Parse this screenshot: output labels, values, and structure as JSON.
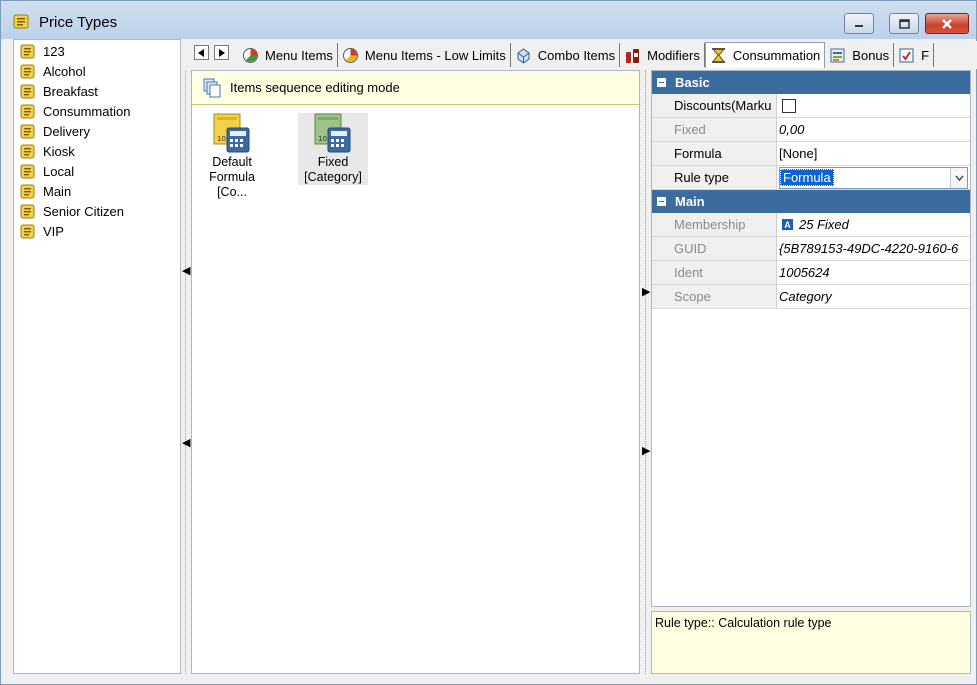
{
  "window": {
    "title": "Price Types"
  },
  "tree": {
    "items": [
      {
        "label": "123"
      },
      {
        "label": "Alcohol"
      },
      {
        "label": "Breakfast"
      },
      {
        "label": "Consummation"
      },
      {
        "label": "Delivery"
      },
      {
        "label": "Kiosk"
      },
      {
        "label": "Local"
      },
      {
        "label": "Main"
      },
      {
        "label": "Senior Citizen"
      },
      {
        "label": "VIP"
      }
    ]
  },
  "tabs": [
    {
      "label": "Menu Items",
      "icon": "menu-items-icon"
    },
    {
      "label": "Menu Items - Low Limits",
      "icon": "menu-items-low-icon"
    },
    {
      "label": "Combo Items",
      "icon": "combo-items-icon"
    },
    {
      "label": "Modifiers",
      "icon": "modifiers-icon"
    },
    {
      "label": "Consummation",
      "icon": "consummation-icon",
      "active": true
    },
    {
      "label": "Bonus",
      "icon": "bonus-icon"
    },
    {
      "label": "F",
      "icon": "f-icon"
    }
  ],
  "center": {
    "banner": "Items sequence editing mode",
    "tiles": [
      {
        "line1": "Default",
        "line2": "Formula [Co..."
      },
      {
        "line1": "Fixed",
        "line2": "[Category]"
      }
    ]
  },
  "props": {
    "basic": {
      "title": "Basic",
      "discounts_label": "Discounts(Marku",
      "fixed_label": "Fixed",
      "fixed_value": "0,00",
      "formula_label": "Formula",
      "formula_value": "[None]",
      "ruletype_label": "Rule type",
      "ruletype_value": "Formula"
    },
    "main": {
      "title": "Main",
      "membership_label": "Membership",
      "membership_badge": "A",
      "membership_value": "25 Fixed",
      "guid_label": "GUID",
      "guid_value": "{5B789153-49DC-4220-9160-6",
      "ident_label": "Ident",
      "ident_value": "1005624",
      "scope_label": "Scope",
      "scope_value": "Category"
    }
  },
  "description": "Rule type:: Calculation rule type"
}
